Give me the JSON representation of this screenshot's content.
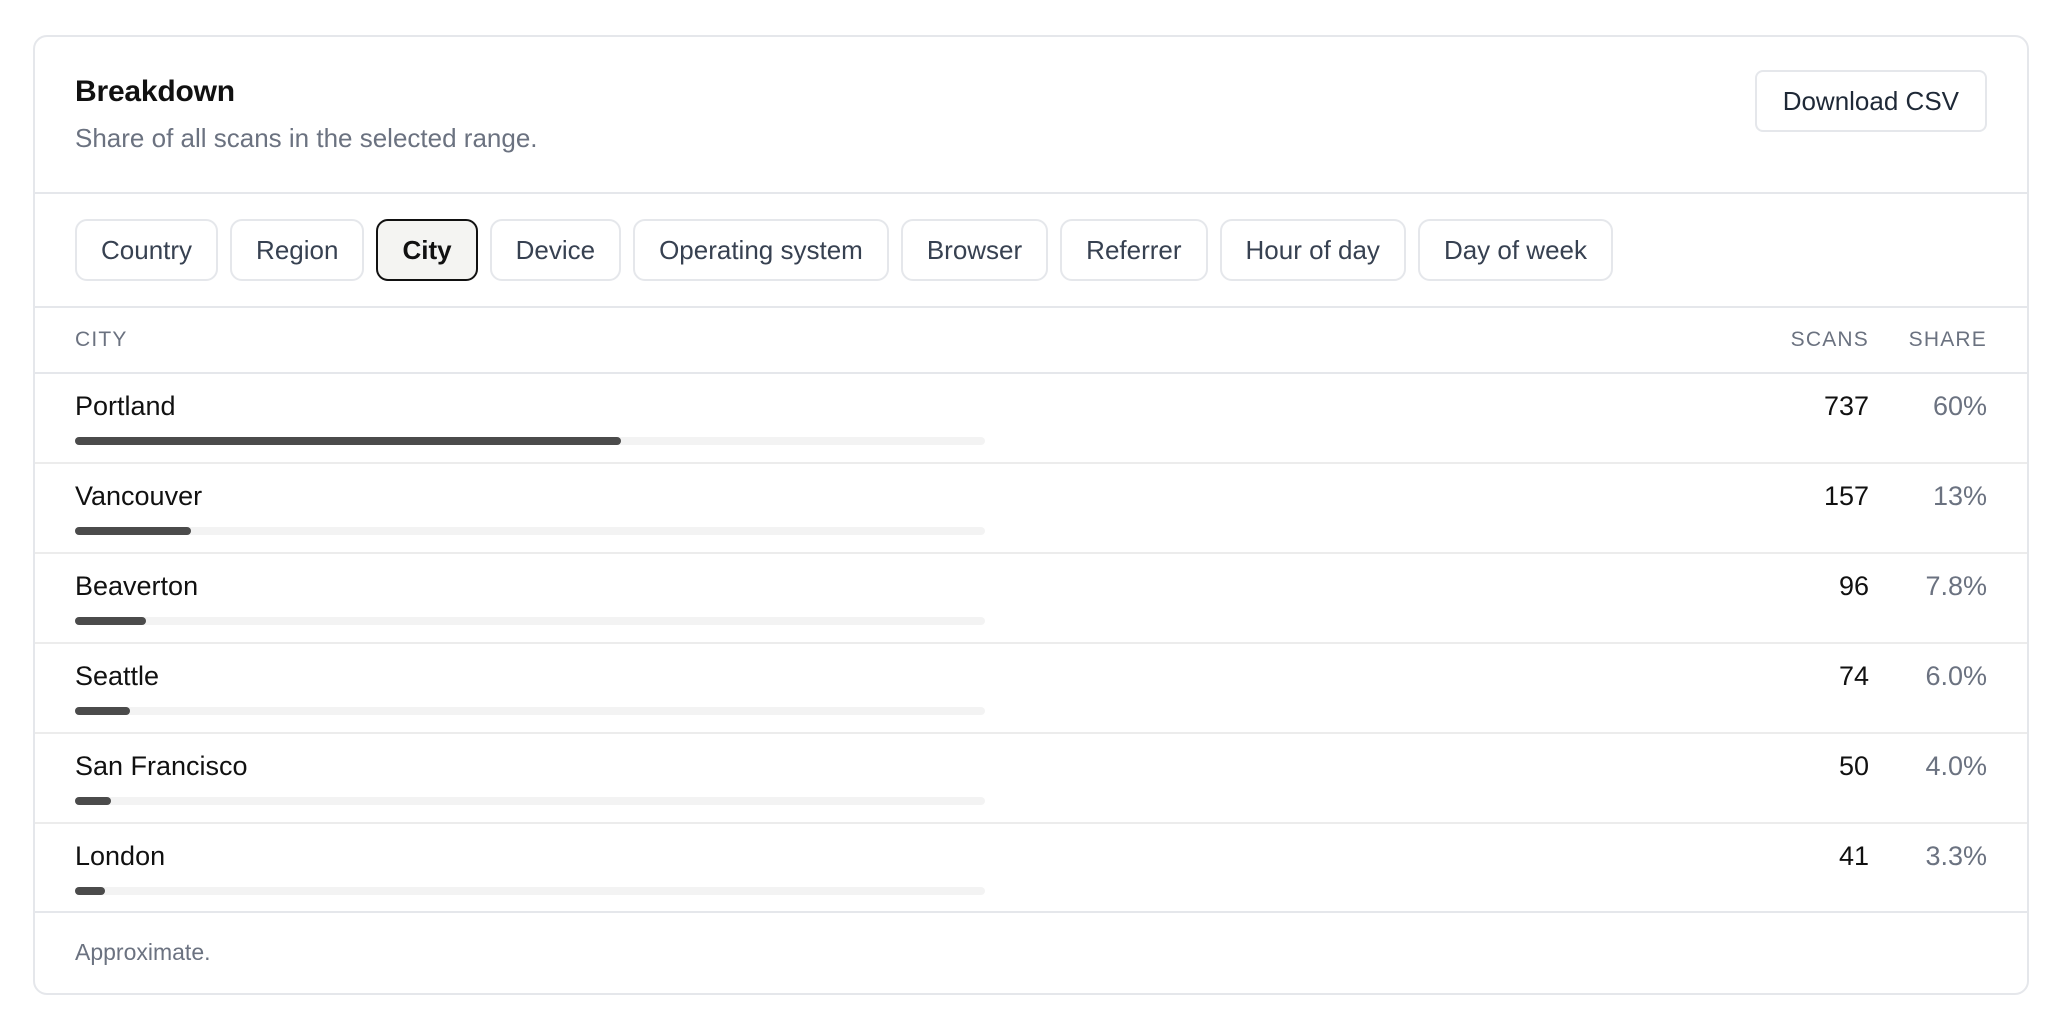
{
  "header": {
    "title": "Breakdown",
    "subtitle": "Share of all scans in the selected range.",
    "download_label": "Download CSV"
  },
  "tabs": [
    {
      "label": "Country",
      "active": false
    },
    {
      "label": "Region",
      "active": false
    },
    {
      "label": "City",
      "active": true
    },
    {
      "label": "Device",
      "active": false
    },
    {
      "label": "Operating system",
      "active": false
    },
    {
      "label": "Browser",
      "active": false
    },
    {
      "label": "Referrer",
      "active": false
    },
    {
      "label": "Hour of day",
      "active": false
    },
    {
      "label": "Day of week",
      "active": false
    }
  ],
  "table": {
    "columns": {
      "name": "CITY",
      "scans": "SCANS",
      "share": "SHARE"
    },
    "rows": [
      {
        "name": "Portland",
        "scans": "737",
        "share": "60%",
        "bar_fraction": 0.6
      },
      {
        "name": "Vancouver",
        "scans": "157",
        "share": "13%",
        "bar_fraction": 0.128
      },
      {
        "name": "Beaverton",
        "scans": "96",
        "share": "7.8%",
        "bar_fraction": 0.078
      },
      {
        "name": "Seattle",
        "scans": "74",
        "share": "6.0%",
        "bar_fraction": 0.06
      },
      {
        "name": "San Francisco",
        "scans": "50",
        "share": "4.0%",
        "bar_fraction": 0.04
      },
      {
        "name": "London",
        "scans": "41",
        "share": "3.3%",
        "bar_fraction": 0.033
      }
    ]
  },
  "footer": {
    "note": "Approximate."
  },
  "colors": {
    "bar_fill": "#4b4b4b",
    "bar_track": "#f3f3f3",
    "active_tab_border": "#111111",
    "active_tab_bg": "#f4f4f2"
  }
}
